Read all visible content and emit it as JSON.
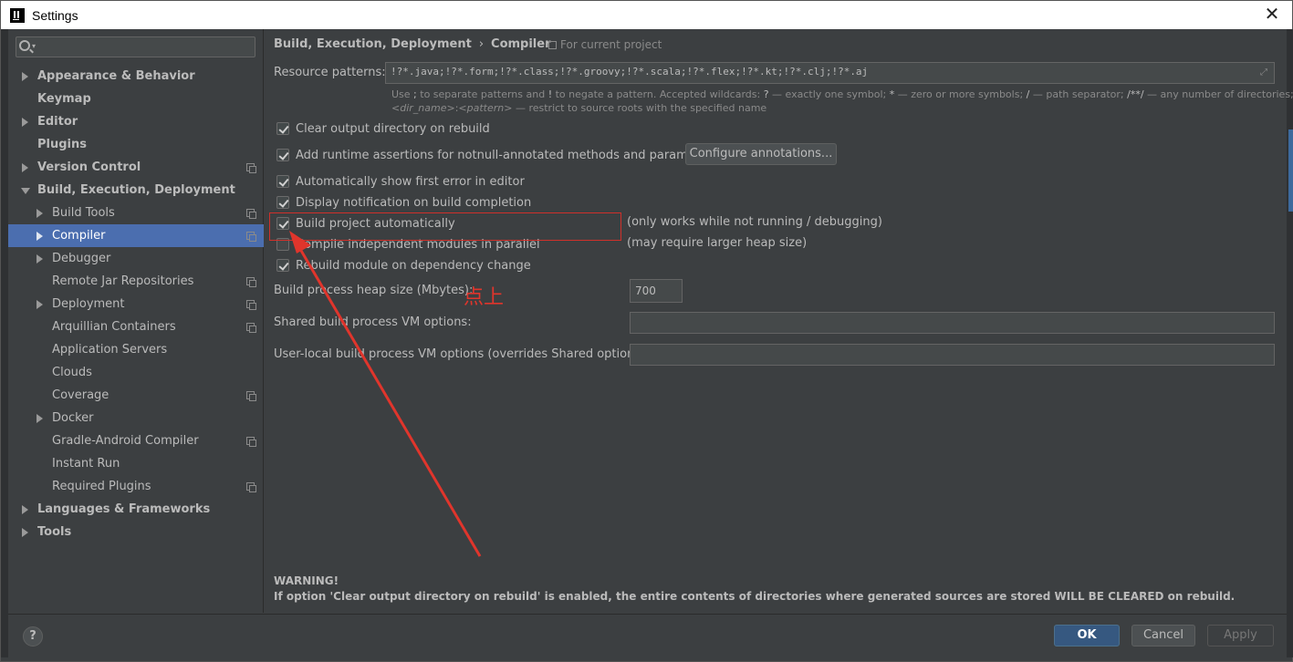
{
  "window": {
    "title": "Settings"
  },
  "sidebar": {
    "search_placeholder": "",
    "items": [
      {
        "label": "Appearance & Behavior"
      },
      {
        "label": "Keymap"
      },
      {
        "label": "Editor"
      },
      {
        "label": "Plugins"
      },
      {
        "label": "Version Control"
      },
      {
        "label": "Build, Execution, Deployment"
      },
      {
        "label": "Build Tools"
      },
      {
        "label": "Compiler"
      },
      {
        "label": "Debugger"
      },
      {
        "label": "Remote Jar Repositories"
      },
      {
        "label": "Deployment"
      },
      {
        "label": "Arquillian Containers"
      },
      {
        "label": "Application Servers"
      },
      {
        "label": "Clouds"
      },
      {
        "label": "Coverage"
      },
      {
        "label": "Docker"
      },
      {
        "label": "Gradle-Android Compiler"
      },
      {
        "label": "Instant Run"
      },
      {
        "label": "Required Plugins"
      },
      {
        "label": "Languages & Frameworks"
      },
      {
        "label": "Tools"
      }
    ]
  },
  "main": {
    "breadcrumb": {
      "parent": "Build, Execution, Deployment",
      "separator": "›",
      "current": "Compiler"
    },
    "scope": "For current project",
    "resource_patterns": {
      "label": "Resource patterns:",
      "value": "!?*.java;!?*.form;!?*.class;!?*.groovy;!?*.scala;!?*.flex;!?*.kt;!?*.clj;!?*.aj",
      "hint_line1_a": "Use ",
      "hint_line1_b": ";",
      "hint_line1_c": " to separate patterns and ",
      "hint_line1_d": "!",
      "hint_line1_e": " to negate a pattern. Accepted wildcards: ",
      "hint_line1_f": "?",
      "hint_line1_g": " — exactly one symbol; ",
      "hint_line1_h": "*",
      "hint_line1_i": " — zero or more symbols; ",
      "hint_line1_j": "/",
      "hint_line1_k": " — path separator; ",
      "hint_line1_l": "/**/",
      "hint_line1_m": " — any number of directories;",
      "hint_line2_a": "<dir_name>",
      "hint_line2_b": ":",
      "hint_line2_c": "<pattern>",
      "hint_line2_d": " — restrict to source roots with the specified name"
    },
    "options": {
      "clear_output": "Clear output directory on rebuild",
      "add_runtime": "Add runtime assertions for notnull-annotated methods and parameters",
      "configure_annotations": "Configure annotations...",
      "show_first_error": "Automatically show first error in editor",
      "display_notification": "Display notification on build completion",
      "build_automatically": "Build project automatically",
      "build_automatically_note": "(only works while not running / debugging)",
      "compile_parallel": "Compile independent modules in parallel",
      "compile_parallel_note": "(may require larger heap size)",
      "rebuild_on_dependency": "Rebuild module on dependency change"
    },
    "heap_size": {
      "label": "Build process heap size (Mbytes):",
      "value": "700"
    },
    "shared_vm": {
      "label": "Shared build process VM options:",
      "value": ""
    },
    "user_vm": {
      "label": "User-local build process VM options (overrides Shared options):",
      "value": ""
    },
    "annotation_text": "点上",
    "warning": {
      "title": "WARNING!",
      "text": "If option 'Clear output directory on rebuild' is enabled, the entire contents of directories where generated sources are stored WILL BE CLEARED on rebuild."
    }
  },
  "footer": {
    "help": "?",
    "ok": "OK",
    "cancel": "Cancel",
    "apply": "Apply"
  },
  "colors": {
    "selected": "#4b6eaf",
    "annotation": "#e0352c",
    "background": "#3c3f41"
  }
}
